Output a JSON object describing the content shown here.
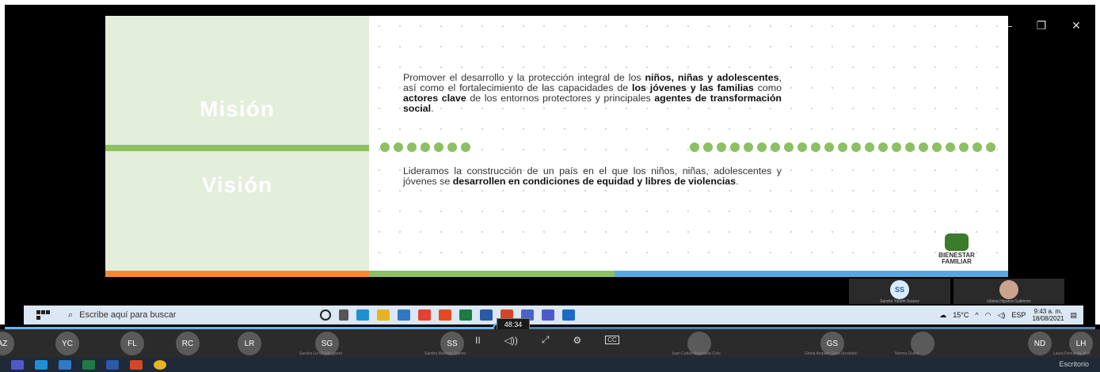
{
  "window": {
    "minimize": "—",
    "restore": "❐",
    "close": "✕"
  },
  "slide": {
    "mision_title": "Misión",
    "vision_title": "Visión",
    "mision_text_html": "Promover el desarrollo y la protección integral de los <b>niños, niñas y adolescentes</b>, así como el fortalecimiento de las capacidades de <b>los jóvenes y las familias</b> como <b>actores clave</b> de los entornos protectores y principales <b>agentes de transformación social</b>.",
    "vision_text_html": "Lideramos la construcción de un país en el que los niños, niñas, adolescentes y jóvenes se <b>desarrollen en condiciones de equidad y libres de violencias</b>.",
    "logo_text": "BIENESTAR FAMILIAR",
    "accent_green": "#8cc063",
    "stripe_colors": [
      "#ef8a3a",
      "#8cc063",
      "#5aa7e0"
    ]
  },
  "participants_top": [
    {
      "initials": "SS",
      "name": "Sandra Yulieth Suarez"
    },
    {
      "initials": "",
      "name": "Liliana Higuera Gutiérrez"
    }
  ],
  "taskbar": {
    "search_placeholder": "Escribe aquí para buscar",
    "weather": "15°C",
    "lang": "ESP",
    "time": "9:43 a. m.",
    "date": "18/08/2021"
  },
  "player": {
    "time_label": "48:34",
    "progress": 0.45,
    "pause_icon": "II",
    "volume_icon": "◁))",
    "expand_icon": "⤢",
    "settings_icon": "⚙",
    "cc_icon": "CC"
  },
  "participants_bottom": [
    {
      "initials": "AZ",
      "name": ""
    },
    {
      "initials": "YC",
      "name": ""
    },
    {
      "initials": "FL",
      "name": ""
    },
    {
      "initials": "RC",
      "name": ""
    },
    {
      "initials": "LR",
      "name": ""
    },
    {
      "initials": "SG",
      "name": "Sandra Liz Osalfe garnd"
    },
    {
      "initials": "SS",
      "name": "Sandra Mabaya Suarez"
    },
    {
      "initials": "",
      "name": "Juan Carlos Avarzuela Colo"
    },
    {
      "initials": "GS",
      "name": "Gloria Amparo Sosa (Invitado)"
    },
    {
      "initials": "",
      "name": "Norma Osaro"
    },
    {
      "initials": "ND",
      "name": ""
    },
    {
      "initials": "LH",
      "name": "Laura Fernanda Muñ"
    }
  ],
  "os": {
    "desktop_label": "Escritorio"
  }
}
